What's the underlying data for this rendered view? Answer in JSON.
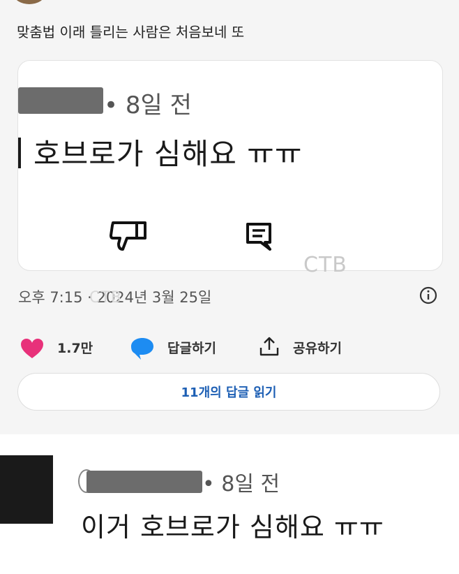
{
  "post": {
    "caption": "맞춤법 이래 틀리는 사람은 처음보네 또"
  },
  "embed": {
    "meta": "• 8일 전",
    "comment_text": "호브로가 심해요 ㅠㅠ"
  },
  "watermark": "CTB",
  "timestamp": "오후 7:15 · 2024년 3월 25일",
  "actions": {
    "like_count": "1.7만",
    "reply_label": "답글하기",
    "share_label": "공유하기"
  },
  "replies_button": {
    "label": "11개의 답글 읽기"
  },
  "bottom_comment": {
    "meta": "• 8일 전",
    "text": "이거 호브로가 심해요 ㅠㅠ"
  },
  "colors": {
    "accent_blue": "#1d5fb4",
    "heart_pink": "#e8317a",
    "comment_blue": "#1d8cf2"
  }
}
